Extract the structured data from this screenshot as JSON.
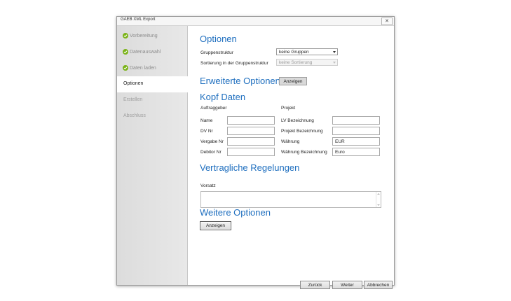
{
  "window": {
    "title": "GAEB XML Export",
    "close_glyph": "✕"
  },
  "sidebar": {
    "items": [
      {
        "label": "Vorbereitung",
        "state": "done",
        "icon": "check-icon"
      },
      {
        "label": "Datenauswahl",
        "state": "done",
        "icon": "check-icon"
      },
      {
        "label": "Daten laden",
        "state": "done",
        "icon": "check-icon"
      },
      {
        "label": "Optionen",
        "state": "active"
      },
      {
        "label": "Erstellen",
        "state": "disabled"
      },
      {
        "label": "Abschluss",
        "state": "disabled"
      }
    ]
  },
  "options": {
    "heading": "Optionen",
    "group_label": "Gruppenstruktur",
    "group_value": "keine Gruppen",
    "sort_label": "Sortierung in der Gruppenstruktur",
    "sort_value": "keine Sortierung"
  },
  "advanced": {
    "heading": "Erweiterte Optionen",
    "button": "Anzeigen"
  },
  "kopf": {
    "heading": "Kopf Daten",
    "col1": "Auftraggeber",
    "col2": "Projekt",
    "left_fields": [
      {
        "label": "Name",
        "value": ""
      },
      {
        "label": "DV Nr",
        "value": ""
      },
      {
        "label": "Vergabe Nr",
        "value": ""
      },
      {
        "label": "Debitor Nr",
        "value": ""
      }
    ],
    "right_fields": [
      {
        "label": "LV Bezeichnung",
        "value": ""
      },
      {
        "label": "Projekt Bezeichnung",
        "value": ""
      },
      {
        "label": "Währung",
        "value": "EUR"
      },
      {
        "label": "Währung Bezeichnung",
        "value": "Euro"
      }
    ]
  },
  "contract": {
    "heading": "Vertragliche Regelungen",
    "vorsatz_label": "Vorsatz",
    "vorsatz_value": ""
  },
  "more": {
    "heading": "Weitere Optionen",
    "button": "Anzeigen"
  },
  "footer": {
    "back": "Zurück",
    "next": "Weiter",
    "cancel": "Abbrechen"
  },
  "colors": {
    "heading": "#1f6fbf",
    "check": "#7ab317"
  }
}
